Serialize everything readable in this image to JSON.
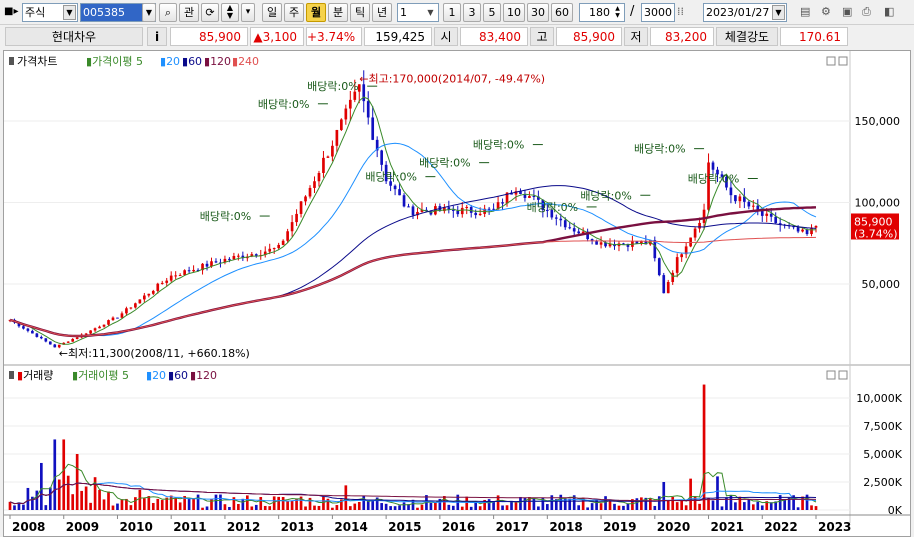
{
  "toolbar": {
    "market": "주식",
    "code": "005385",
    "btn_gwan": "관",
    "periods": [
      "일",
      "주",
      "월",
      "분",
      "틱",
      "년"
    ],
    "selected_period": "월",
    "unit_value": "1",
    "intervals": [
      "1",
      "3",
      "5",
      "10",
      "30",
      "60"
    ],
    "count_value": "180",
    "slash": "/",
    "total_value": "3000",
    "date_value": "2023/01/27"
  },
  "info": {
    "name": "현대차우",
    "i_btn": "i",
    "price": "85,900",
    "change": "▲3,100",
    "change_pct": "+3.74%",
    "volume": "159,425",
    "open_label": "시",
    "open": "83,400",
    "high_label": "고",
    "high": "85,900",
    "low_label": "저",
    "low": "83,200",
    "strength_label": "체결강도",
    "strength": "170.61"
  },
  "price_panel": {
    "title": "가격차트",
    "ma_label": "가격이평",
    "ma": [
      "5",
      "20",
      "60",
      "120",
      "240"
    ],
    "colors": {
      "ma5": "#3a8a2a",
      "ma20": "#1e90ff",
      "ma60": "#0a0a8a",
      "ma120": "#7a1040",
      "ma240": "#e05050",
      "up": "#e00000",
      "down": "#1010c0"
    },
    "y_ticks": [
      "150,000",
      "100,000",
      "50,000"
    ],
    "current_price": "85,900",
    "current_pct": "(3.74%)",
    "max_note": "←최고:170,000(2014/07, -49.47%)",
    "min_note": "←최저:11,300(2008/11, +660.18%)",
    "dividend_label": "배당락:0%"
  },
  "volume_panel": {
    "title": "거래량",
    "ma_label": "거래이평",
    "ma": [
      "5",
      "20",
      "60",
      "120"
    ],
    "y_ticks": [
      "10,000K",
      "7,500K",
      "5,000K",
      "2,500K",
      "0K"
    ]
  },
  "x_axis": [
    "2008",
    "2009",
    "2010",
    "2011",
    "2012",
    "2013",
    "2014",
    "2015",
    "2016",
    "2017",
    "2018",
    "2019",
    "2020",
    "2021",
    "2022",
    "2023"
  ],
  "chart_data": {
    "type": "candlestick",
    "period": "monthly",
    "x_range": [
      "2008/01",
      "2023/01"
    ],
    "price_ylim": [
      11300,
      170000
    ],
    "price_points": [
      {
        "date": "2008/01",
        "close": 28000
      },
      {
        "date": "2008/11",
        "close": 11300
      },
      {
        "date": "2009/06",
        "close": 20000
      },
      {
        "date": "2010/01",
        "close": 30000
      },
      {
        "date": "2011/01",
        "close": 55000
      },
      {
        "date": "2012/01",
        "close": 65000
      },
      {
        "date": "2013/01",
        "close": 72000
      },
      {
        "date": "2013/10",
        "close": 120000
      },
      {
        "date": "2014/07",
        "close": 170000
      },
      {
        "date": "2015/01",
        "close": 115000
      },
      {
        "date": "2015/06",
        "close": 95000
      },
      {
        "date": "2016/01",
        "close": 95000
      },
      {
        "date": "2017/01",
        "close": 95000
      },
      {
        "date": "2017/06",
        "close": 110000
      },
      {
        "date": "2018/06",
        "close": 85000
      },
      {
        "date": "2019/01",
        "close": 75000
      },
      {
        "date": "2019/12",
        "close": 75000
      },
      {
        "date": "2020/03",
        "close": 45000
      },
      {
        "date": "2020/06",
        "close": 65000
      },
      {
        "date": "2020/12",
        "close": 95000
      },
      {
        "date": "2021/01",
        "close": 125000
      },
      {
        "date": "2021/06",
        "close": 105000
      },
      {
        "date": "2022/01",
        "close": 92000
      },
      {
        "date": "2022/06",
        "close": 85000
      },
      {
        "date": "2022/11",
        "close": 80000
      },
      {
        "date": "2023/01",
        "close": 85900
      }
    ],
    "volume_ylim_k": [
      0,
      11000
    ],
    "volume_points_k": [
      {
        "date": "2008/08",
        "value": 4200
      },
      {
        "date": "2008/11",
        "value": 6300
      },
      {
        "date": "2009/01",
        "value": 6300
      },
      {
        "date": "2009/04",
        "value": 5000
      },
      {
        "date": "2010/06",
        "value": 1800
      },
      {
        "date": "2013/06",
        "value": 1200
      },
      {
        "date": "2014/04",
        "value": 2200
      },
      {
        "date": "2018/06",
        "value": 1000
      },
      {
        "date": "2020/03",
        "value": 2500
      },
      {
        "date": "2020/09",
        "value": 2800
      },
      {
        "date": "2020/12",
        "value": 11200
      },
      {
        "date": "2021/03",
        "value": 3000
      },
      {
        "date": "2022/06",
        "value": 900
      }
    ]
  }
}
